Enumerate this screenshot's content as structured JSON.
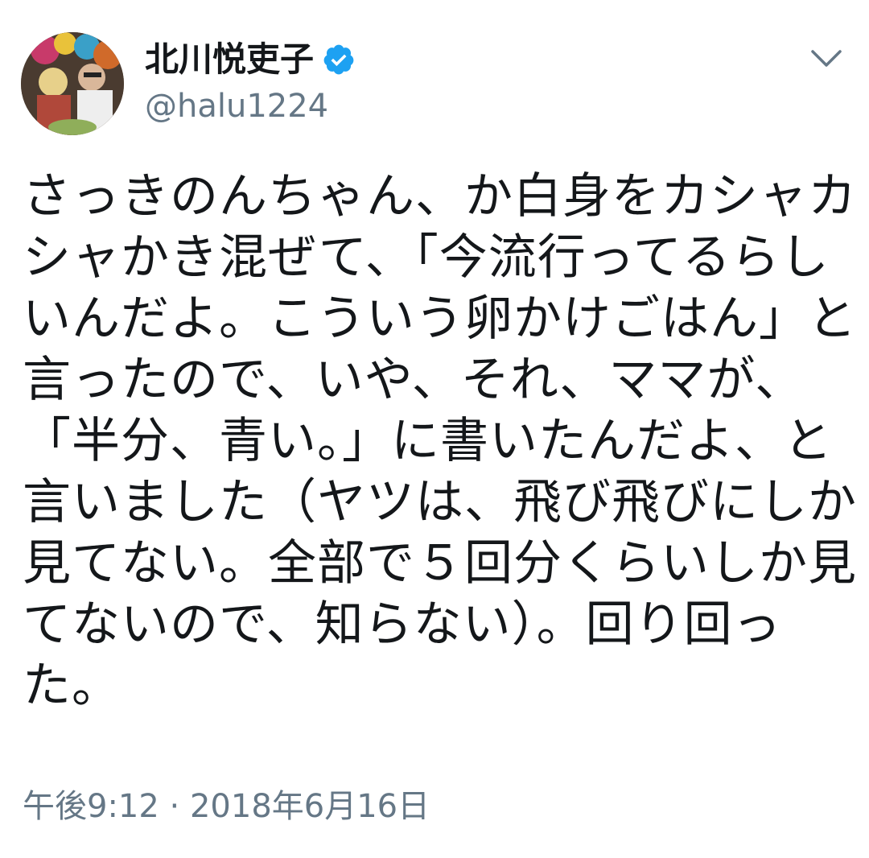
{
  "tweet": {
    "display_name": "北川悦吏子",
    "verified": true,
    "handle": "@halu1224",
    "body_lines": [
      "さっきのんちゃん、か白身をカシャカ",
      "シャかき混ぜて、「今流行ってるらし",
      "いんだよ。こういう卵かけごはん」と",
      "言ったので、いや、それ、ママが、",
      "「半分、青い。」に書いたんだよ、と",
      "言いました（ヤツは、飛び飛びにしか",
      "見てない。全部で５回分くらいしか見",
      "てないので、知らない）。回り回っ",
      "た。"
    ],
    "timestamp": "午後9:12 · 2018年6月16日"
  },
  "icons": {
    "verified": "verified-badge-icon",
    "more": "chevron-down-icon"
  },
  "colors": {
    "text": "#14171a",
    "secondary": "#657786",
    "verified_blue": "#1da1f2"
  }
}
